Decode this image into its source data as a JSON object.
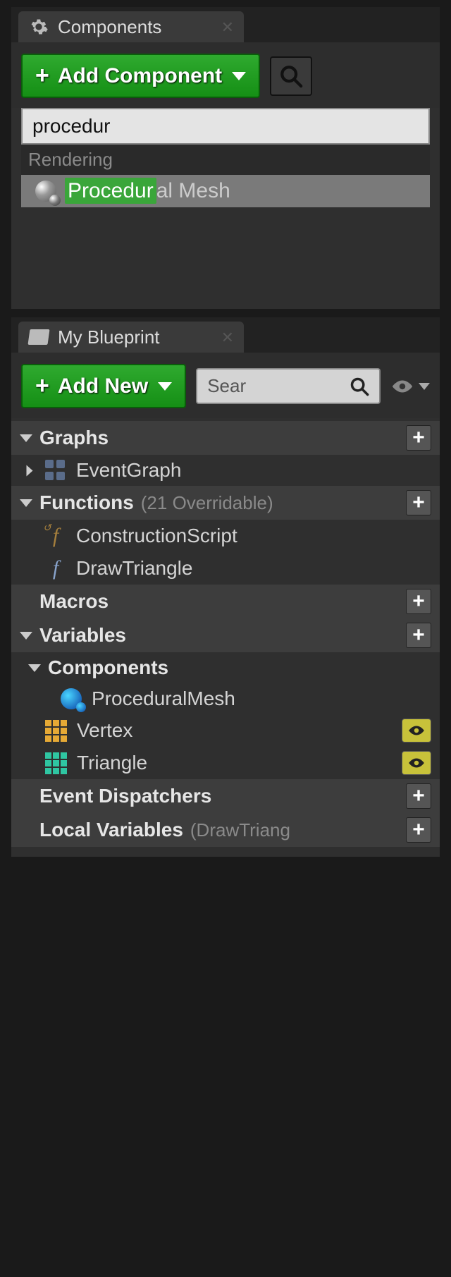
{
  "components_panel": {
    "tab_title": "Components",
    "add_button_label": "Add Component",
    "search_value": "procedur",
    "category": "Rendering",
    "result": {
      "highlight": "Procedur",
      "rest": "al Mesh"
    }
  },
  "blueprint_panel": {
    "tab_title": "My Blueprint",
    "add_button_label": "Add New",
    "search_placeholder": "Sear",
    "sections": {
      "graphs": {
        "label": "Graphs",
        "items": [
          "EventGraph"
        ]
      },
      "functions": {
        "label": "Functions",
        "suffix": "(21 Overridable)",
        "items": [
          "ConstructionScript",
          "DrawTriangle"
        ]
      },
      "macros": {
        "label": "Macros"
      },
      "variables": {
        "label": "Variables"
      },
      "components": {
        "label": "Components",
        "items": [
          "ProceduralMesh",
          "Vertex",
          "Triangle"
        ]
      },
      "event_dispatchers": {
        "label": "Event Dispatchers"
      },
      "local_variables": {
        "label": "Local Variables",
        "suffix": "(DrawTriang"
      }
    }
  }
}
